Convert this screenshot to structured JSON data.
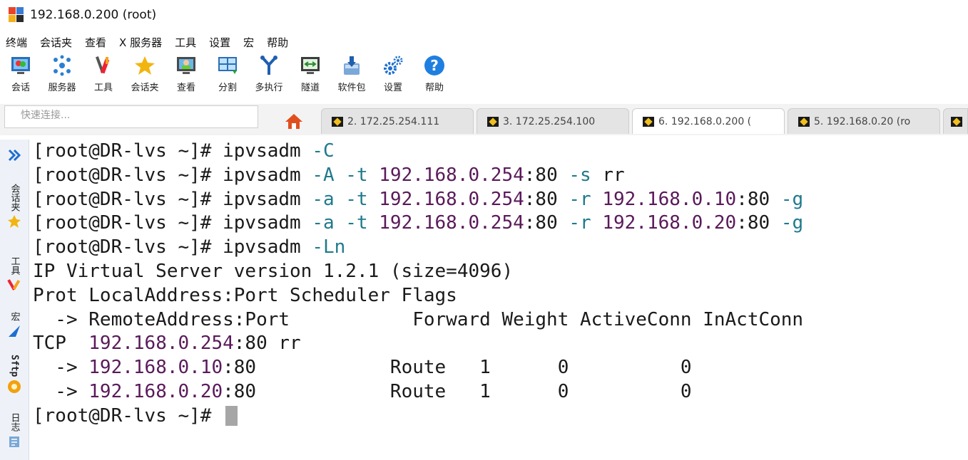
{
  "window": {
    "title": "192.168.0.200  (root)"
  },
  "menu": [
    "终端",
    "会话夹",
    "查看",
    "X 服务器",
    "工具",
    "设置",
    "宏",
    "帮助"
  ],
  "toolbar": [
    {
      "label": "会话",
      "icon": "session-icon"
    },
    {
      "label": "服务器",
      "icon": "servers-icon"
    },
    {
      "label": "工具",
      "icon": "tools-icon"
    },
    {
      "label": "会话夹",
      "icon": "star-icon"
    },
    {
      "label": "查看",
      "icon": "view-icon"
    },
    {
      "label": "分割",
      "icon": "split-icon"
    },
    {
      "label": "多执行",
      "icon": "multiexec-icon"
    },
    {
      "label": "隧道",
      "icon": "tunnel-icon"
    },
    {
      "label": "软件包",
      "icon": "packages-icon"
    },
    {
      "label": "设置",
      "icon": "settings-icon"
    },
    {
      "label": "帮助",
      "icon": "help-icon"
    }
  ],
  "quick_connect": {
    "placeholder": "快速连接..."
  },
  "tabs": [
    {
      "label": "2. 172.25.254.111",
      "active": false
    },
    {
      "label": "3. 172.25.254.100",
      "active": false
    },
    {
      "label": "6. 192.168.0.200  (",
      "active": true
    },
    {
      "label": "5. 192.168.0.20 (ro",
      "active": false
    }
  ],
  "sidebar": [
    "会话夹",
    "工具",
    "宏",
    "Sftp",
    "日志"
  ],
  "terminal": {
    "prompt": "[root@DR-lvs ~]#",
    "commands": [
      [
        {
          "t": "ipvsadm ",
          "c": "cmd"
        },
        {
          "t": "-C",
          "c": "opt"
        }
      ],
      [
        {
          "t": "ipvsadm ",
          "c": "cmd"
        },
        {
          "t": "-A -t ",
          "c": "opt"
        },
        {
          "t": "192.168.0.254",
          "c": "ipv"
        },
        {
          "t": ":80 ",
          "c": "cmd"
        },
        {
          "t": "-s ",
          "c": "opt"
        },
        {
          "t": "rr",
          "c": "cmd"
        }
      ],
      [
        {
          "t": "ipvsadm ",
          "c": "cmd"
        },
        {
          "t": "-a -t ",
          "c": "opt"
        },
        {
          "t": "192.168.0.254",
          "c": "ipv"
        },
        {
          "t": ":80 ",
          "c": "cmd"
        },
        {
          "t": "-r ",
          "c": "opt"
        },
        {
          "t": "192.168.0.10",
          "c": "ipv"
        },
        {
          "t": ":80 ",
          "c": "cmd"
        },
        {
          "t": "-g",
          "c": "opt"
        }
      ],
      [
        {
          "t": "ipvsadm ",
          "c": "cmd"
        },
        {
          "t": "-a -t ",
          "c": "opt"
        },
        {
          "t": "192.168.0.254",
          "c": "ipv"
        },
        {
          "t": ":80 ",
          "c": "cmd"
        },
        {
          "t": "-r ",
          "c": "opt"
        },
        {
          "t": "192.168.0.20",
          "c": "ipv"
        },
        {
          "t": ":80 ",
          "c": "cmd"
        },
        {
          "t": "-g",
          "c": "opt"
        }
      ],
      [
        {
          "t": "ipvsadm ",
          "c": "cmd"
        },
        {
          "t": "-Ln",
          "c": "opt"
        }
      ]
    ],
    "output": [
      [
        {
          "t": "IP Virtual Server version 1.2.1 (size=4096)",
          "c": "cmd"
        }
      ],
      [
        {
          "t": "Prot LocalAddress:Port Scheduler Flags",
          "c": "cmd"
        }
      ],
      [
        {
          "t": "  -> RemoteAddress:Port           Forward Weight ActiveConn InActConn",
          "c": "cmd"
        }
      ],
      [
        {
          "t": "TCP  ",
          "c": "cmd"
        },
        {
          "t": "192.168.0.254",
          "c": "ipv"
        },
        {
          "t": ":80 rr",
          "c": "cmd"
        }
      ],
      [
        {
          "t": "  -> ",
          "c": "cmd"
        },
        {
          "t": "192.168.0.10",
          "c": "ipv"
        },
        {
          "t": ":80            Route   1      0          0",
          "c": "cmd"
        }
      ],
      [
        {
          "t": "  -> ",
          "c": "cmd"
        },
        {
          "t": "192.168.0.20",
          "c": "ipv"
        },
        {
          "t": ":80            Route   1      0          0",
          "c": "cmd"
        }
      ]
    ]
  },
  "colors": {
    "option": "#1f7a8c",
    "ip": "#5a1a5a",
    "text": "#1a1a1a",
    "cursor": "#a6a6a6"
  }
}
